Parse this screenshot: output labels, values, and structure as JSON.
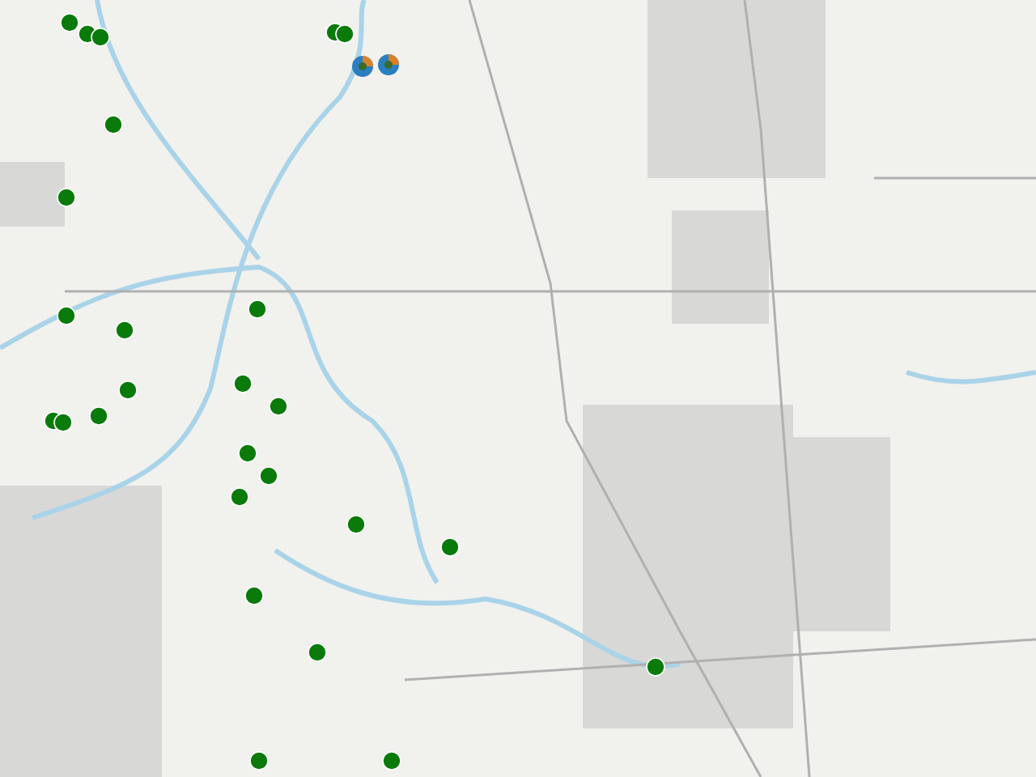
{
  "map": {
    "markers": [
      {
        "kind": "dot"
      },
      {
        "kind": "dot"
      },
      {
        "kind": "dot"
      },
      {
        "kind": "dot"
      },
      {
        "kind": "dot"
      },
      {
        "kind": "dot"
      },
      {
        "kind": "dot"
      },
      {
        "kind": "dot"
      },
      {
        "kind": "dot"
      },
      {
        "kind": "dot"
      },
      {
        "kind": "dot"
      },
      {
        "kind": "dot"
      },
      {
        "kind": "dot"
      },
      {
        "kind": "dot"
      },
      {
        "kind": "dot"
      },
      {
        "kind": "dot"
      },
      {
        "kind": "dot"
      },
      {
        "kind": "dot"
      },
      {
        "kind": "dot"
      },
      {
        "kind": "dot"
      },
      {
        "kind": "dot"
      },
      {
        "kind": "dot"
      },
      {
        "kind": "dot"
      },
      {
        "kind": "dot"
      },
      {
        "kind": "dot"
      },
      {
        "kind": "dot"
      },
      {
        "kind": "cluster"
      },
      {
        "kind": "cluster"
      }
    ]
  }
}
